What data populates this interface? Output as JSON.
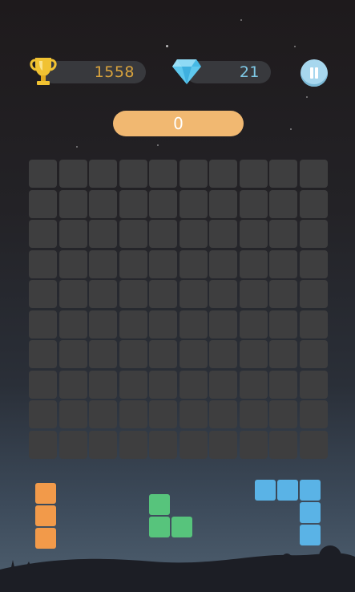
{
  "hud": {
    "best_score": "1558",
    "gems": "21",
    "current_score": "0"
  },
  "board": {
    "rows": 10,
    "cols": 10
  },
  "pieces": [
    {
      "name": "orange-i3-piece",
      "color": "#f29a4a",
      "orientation": "vertical-3"
    },
    {
      "name": "green-l-piece",
      "color": "#57c47c",
      "orientation": "l-shape"
    },
    {
      "name": "blue-j-piece",
      "color": "#5ab3e6",
      "orientation": "hook"
    }
  ],
  "colors": {
    "accent_orange": "#f1b871",
    "gold_text": "#d9a33d",
    "gem_text": "#7fc9e6",
    "pause_button": "#a7d7ee",
    "cell_empty": "#3e3e3f"
  },
  "icons": [
    "trophy-icon",
    "diamond-icon",
    "pause-icon"
  ]
}
